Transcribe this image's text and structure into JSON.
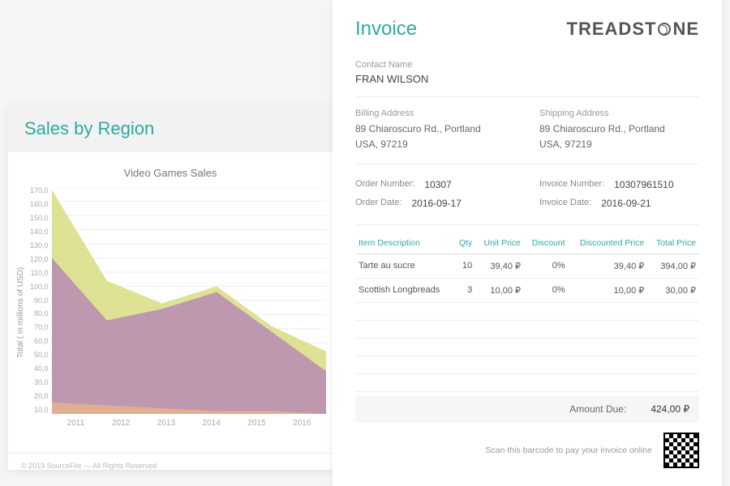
{
  "chart_card": {
    "title": "Sales by Region",
    "footer": "© 2019 SourceFile — All Rights Reserved"
  },
  "chart_data": {
    "type": "area",
    "title": "Video Games Sales",
    "xlabel": "",
    "ylabel": "Total ( in millions of USD)",
    "categories": [
      "2011",
      "2012",
      "2013",
      "2014",
      "2015",
      "2016"
    ],
    "yticks": [
      "170,0",
      "160,0",
      "150,0",
      "140,0",
      "130,0",
      "120,0",
      "110,0",
      "100,0",
      "90,0",
      "80,0",
      "70,0",
      "60,0",
      "50,0",
      "40,0",
      "30,0",
      "20,0",
      "10,0"
    ],
    "ylim": [
      10,
      170
    ],
    "series": [
      {
        "name": "Yellow",
        "color": "#d8dd82",
        "values": [
          168,
          104,
          88,
          100,
          72,
          54
        ]
      },
      {
        "name": "Purple",
        "color": "#b88bb3",
        "values": [
          120,
          76,
          84,
          96,
          68,
          40
        ]
      },
      {
        "name": "Orange",
        "color": "#e9b18d",
        "values": [
          18,
          16,
          14,
          12,
          12,
          10
        ]
      }
    ]
  },
  "invoice": {
    "heading": "Invoice",
    "brand": "TREADSTONE",
    "contact": {
      "label": "Contact Name",
      "value": "FRAN WILSON"
    },
    "billing": {
      "label": "Billing Address",
      "line1": "89 Chiaroscuro Rd., Portland",
      "line2": "USA, 97219"
    },
    "shipping": {
      "label": "Shipping Address",
      "line1": "89 Chiaroscuro Rd., Portland",
      "line2": "USA, 97219"
    },
    "order": {
      "number_label": "Order Number:",
      "number": "10307",
      "date_label": "Order Date:",
      "date": "2016-09-17"
    },
    "inv": {
      "number_label": "Invoice Number:",
      "number": "10307961510",
      "date_label": "Invoice Date:",
      "date": "2016-09-21"
    },
    "columns": {
      "desc": "Item Description",
      "qty": "Qty",
      "unit": "Unit Price",
      "disc": "Discount",
      "discp": "Discounted Price",
      "total": "Total Price"
    },
    "items": [
      {
        "desc": "Tarte au sucre",
        "qty": "10",
        "unit": "39,40 ₽",
        "disc": "0%",
        "discp": "39,40 ₽",
        "total": "394,00 ₽"
      },
      {
        "desc": "Scottish Longbreads",
        "qty": "3",
        "unit": "10,00 ₽",
        "disc": "0%",
        "discp": "10,00 ₽",
        "total": "30,00 ₽"
      }
    ],
    "amount_due": {
      "label": "Amount Due:",
      "value": "424,00 ₽"
    },
    "barcode_text": "Scan this barcode to pay your invoice online"
  }
}
